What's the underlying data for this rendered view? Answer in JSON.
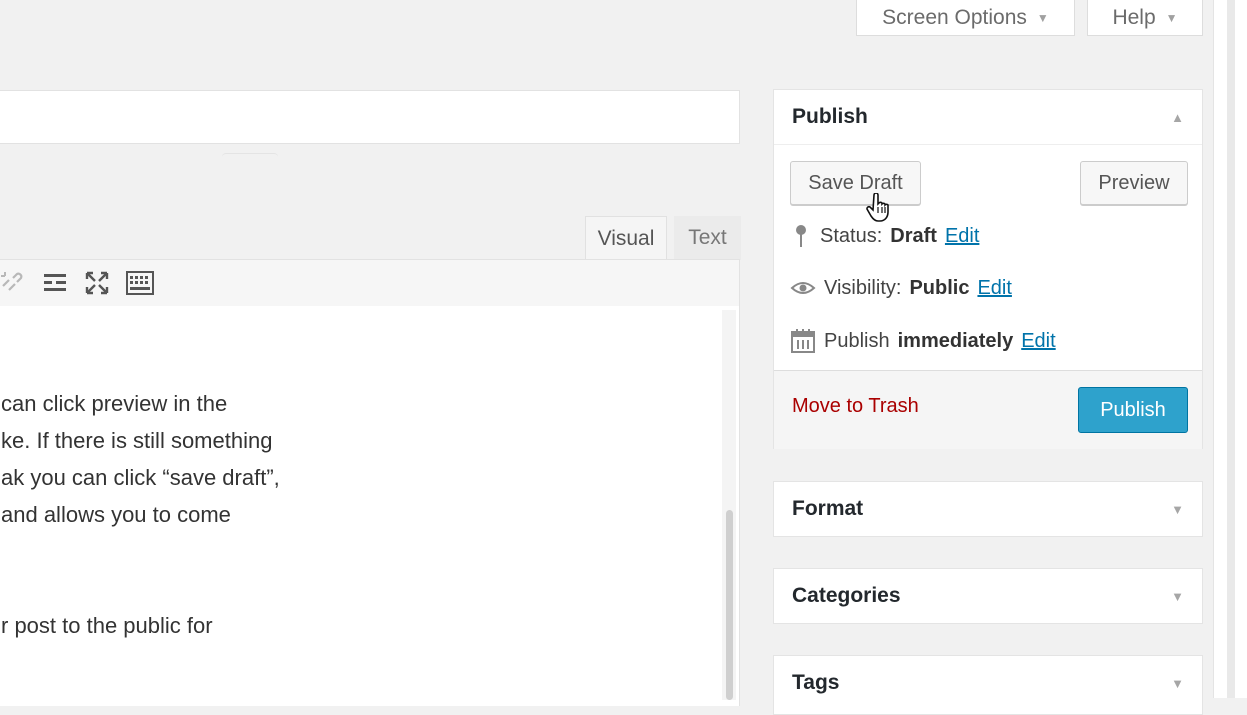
{
  "screen_meta": {
    "screen_options": "Screen Options",
    "help": "Help"
  },
  "editor": {
    "tab_visual": "Visual",
    "tab_text": "Text",
    "toolbar_icons": [
      "unlink-icon",
      "read-more-icon",
      "fullscreen-icon",
      "toolbar-toggle-icon"
    ],
    "lines": [
      "can click preview in the",
      "ke. If there is still something",
      "ak you can click “save draft”,",
      " and allows you to come",
      "r post to the public for"
    ]
  },
  "publish_box": {
    "title": "Publish",
    "save_draft": "Save Draft",
    "preview": "Preview",
    "status_label": "Status:",
    "status_value": "Draft",
    "visibility_label": "Visibility:",
    "visibility_value": "Public",
    "schedule_label": "Publish",
    "schedule_value": "immediately",
    "edit": "Edit",
    "move_to_trash": "Move to Trash",
    "publish": "Publish"
  },
  "boxes": {
    "format": "Format",
    "categories": "Categories",
    "tags": "Tags"
  },
  "colors": {
    "primary_button": "#2ea2cc",
    "link": "#0073aa",
    "trash": "#a00000"
  }
}
